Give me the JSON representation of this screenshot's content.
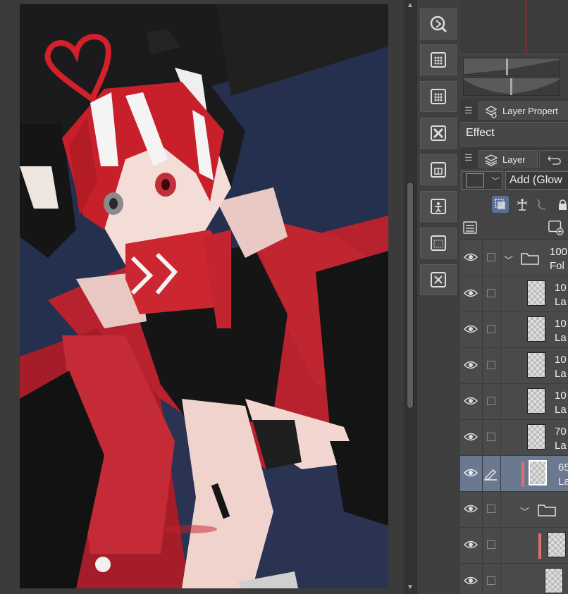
{
  "canvas": {
    "image_description_icon": "artwork-illustration"
  },
  "command_bar": {
    "buttons": [
      "zoom-icon",
      "grid-frame-icon",
      "grid-frame-icon-2",
      "close-frame-icon",
      "panel-frame-icon",
      "figure-frame-icon",
      "dot-frame-icon",
      "scissors-frame-icon"
    ]
  },
  "panel": {
    "layer_properties_tab": "Layer Propert",
    "effect_label": "Effect",
    "layer_tab": "Layer",
    "blend_mode": "Add (Glow",
    "colors": {
      "selected_row": "#6a7890",
      "red_tag": "#e07070",
      "navigator_line": "#c0282c"
    }
  },
  "layers": [
    {
      "name_line1": "100",
      "name_line2": "Fol",
      "type": "folder"
    },
    {
      "name_line1": "10",
      "name_line2": "La",
      "type": "layer"
    },
    {
      "name_line1": "10",
      "name_line2": "La",
      "type": "layer"
    },
    {
      "name_line1": "10",
      "name_line2": "La",
      "type": "layer"
    },
    {
      "name_line1": "10",
      "name_line2": "La",
      "type": "layer"
    },
    {
      "name_line1": "70",
      "name_line2": "La",
      "type": "layer"
    },
    {
      "name_line1": "65",
      "name_line2": "La",
      "type": "layer",
      "selected": true
    },
    {
      "name_line1": "",
      "name_line2": "",
      "type": "folder"
    },
    {
      "name_line1": "",
      "name_line2": "",
      "type": "layer"
    },
    {
      "name_line1": "",
      "name_line2": "",
      "type": "layer"
    }
  ]
}
